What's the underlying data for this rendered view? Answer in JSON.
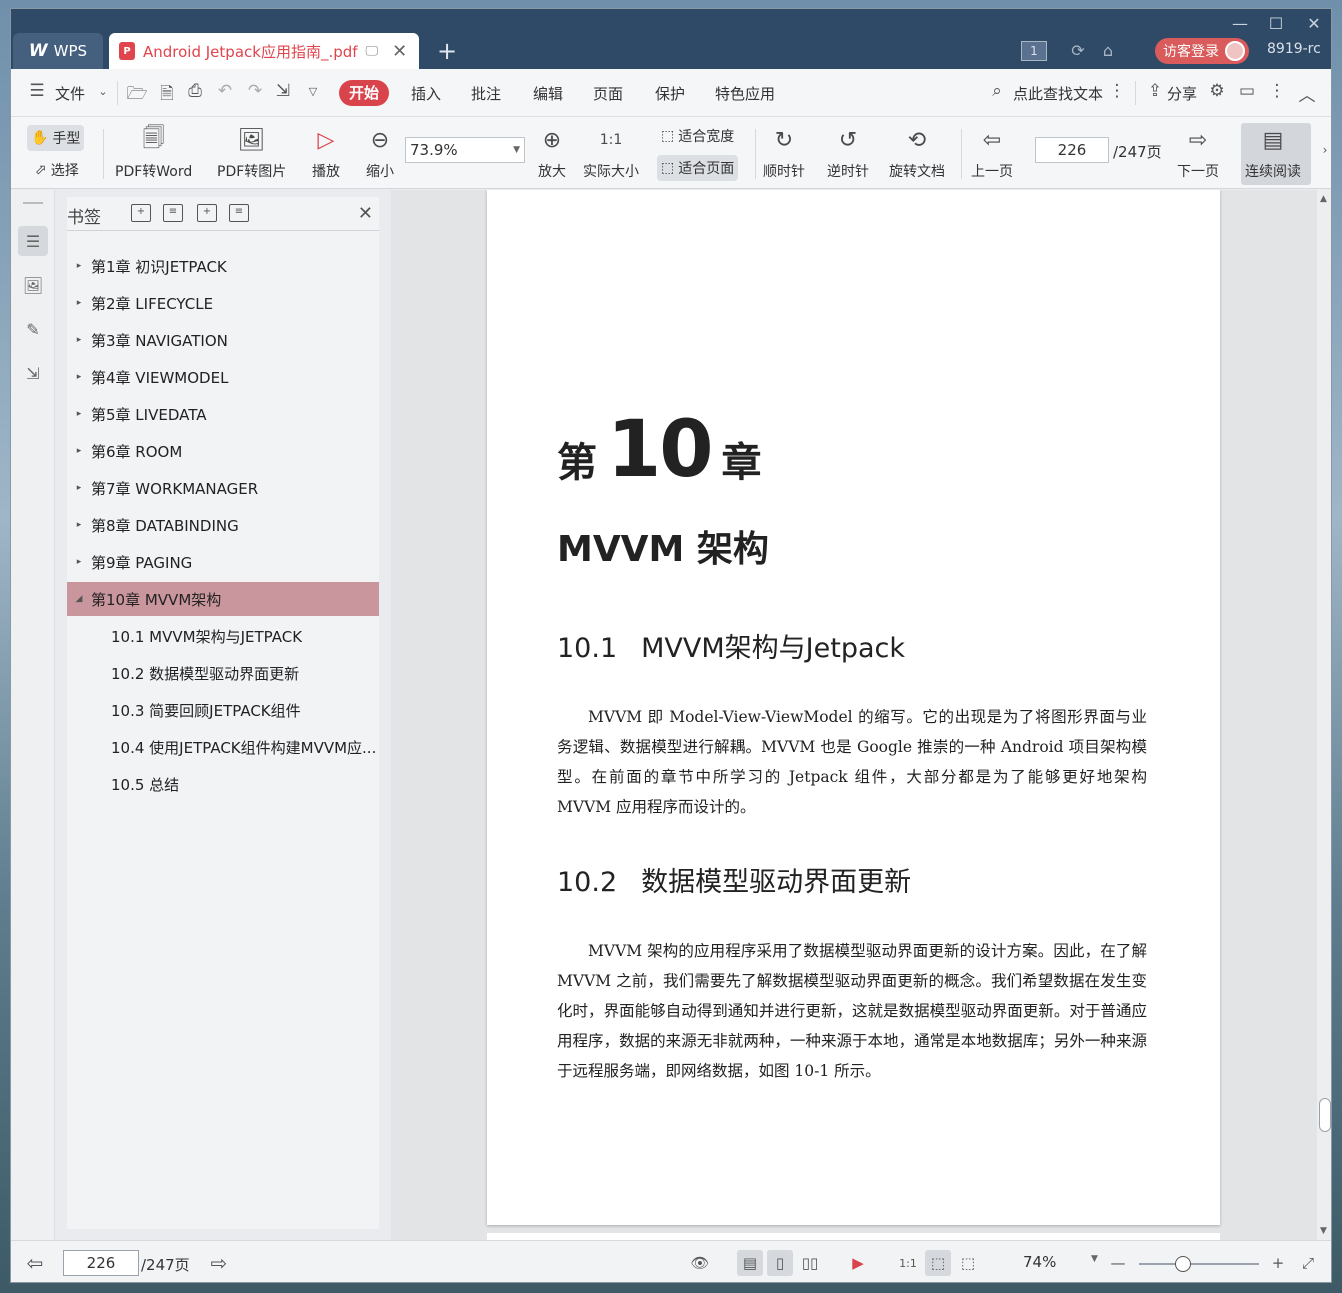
{
  "app": {
    "name": "WPS",
    "doc_tab_title": "Android Jetpack应用指南_.pdf",
    "page_count_badge": "1",
    "login_label": "访客登录",
    "user_id": "8919-rc"
  },
  "menubar": {
    "file": "文件",
    "items": [
      "开始",
      "插入",
      "批注",
      "编辑",
      "页面",
      "保护",
      "特色应用"
    ],
    "search": "点此查找文本",
    "share": "分享"
  },
  "toolbar": {
    "hand": "手型",
    "select": "选择",
    "pdf_to_word": "PDF转Word",
    "pdf_to_image": "PDF转图片",
    "play": "播放",
    "zoom_out": "缩小",
    "zoom_value": "73.9%",
    "zoom_in": "放大",
    "actual_size": "实际大小",
    "fit_width": "适合宽度",
    "fit_page": "适合页面",
    "clockwise": "顺时针",
    "counter_clockwise": "逆时针",
    "rotate_doc": "旋转文档",
    "prev_page": "上一页",
    "current_page": "226",
    "total_pages": "/247页",
    "next_page": "下一页",
    "continuous": "连续阅读"
  },
  "bookmarks": {
    "title": "书签",
    "items": [
      "第1章 初识JETPACK",
      "第2章 LIFECYCLE",
      "第3章 NAVIGATION",
      "第4章 VIEWMODEL",
      "第5章 LIVEDATA",
      "第6章 ROOM",
      "第7章 WORKMANAGER",
      "第8章 DATABINDING",
      "第9章 PAGING",
      "第10章 MVVM架构"
    ],
    "sub_items": [
      "10.1 MVVM架构与JETPACK",
      "10.2 数据模型驱动界面更新",
      "10.3 简要回顾JETPACK组件",
      "10.4 使用JETPACK组件构建MVVM应...",
      "10.5 总结"
    ]
  },
  "document": {
    "chapter_prefix": "第",
    "chapter_number": "10",
    "chapter_suffix": "章",
    "chapter_title": "MVVM 架构",
    "sec1_num": "10.1",
    "sec1_title": "MVVM架构与Jetpack",
    "para1": "MVVM 即 Model-View-ViewModel 的缩写。它的出现是为了将图形界面与业务逻辑、数据模型进行解耦。MVVM 也是 Google 推崇的一种 Android 项目架构模型。在前面的章节中所学习的 Jetpack 组件，大部分都是为了能够更好地架构 MVVM 应用程序而设计的。",
    "sec2_num": "10.2",
    "sec2_title": "数据模型驱动界面更新",
    "para2": "MVVM 架构的应用程序采用了数据模型驱动界面更新的设计方案。因此，在了解 MVVM 之前，我们需要先了解数据模型驱动界面更新的概念。我们希望数据在发生变化时，界面能够自动得到通知并进行更新，这就是数据模型驱动界面更新。对于普通应用程序，数据的来源无非就两种，一种来源于本地，通常是本地数据库；另外一种来源于远程服务端，即网络数据，如图 10-1 所示。"
  },
  "statusbar": {
    "page": "226",
    "total": "/247页",
    "zoom": "74%"
  },
  "colors": {
    "accent": "#d9434b",
    "titlebar": "#2f4a66",
    "selected_bookmark": "#c9969d"
  }
}
